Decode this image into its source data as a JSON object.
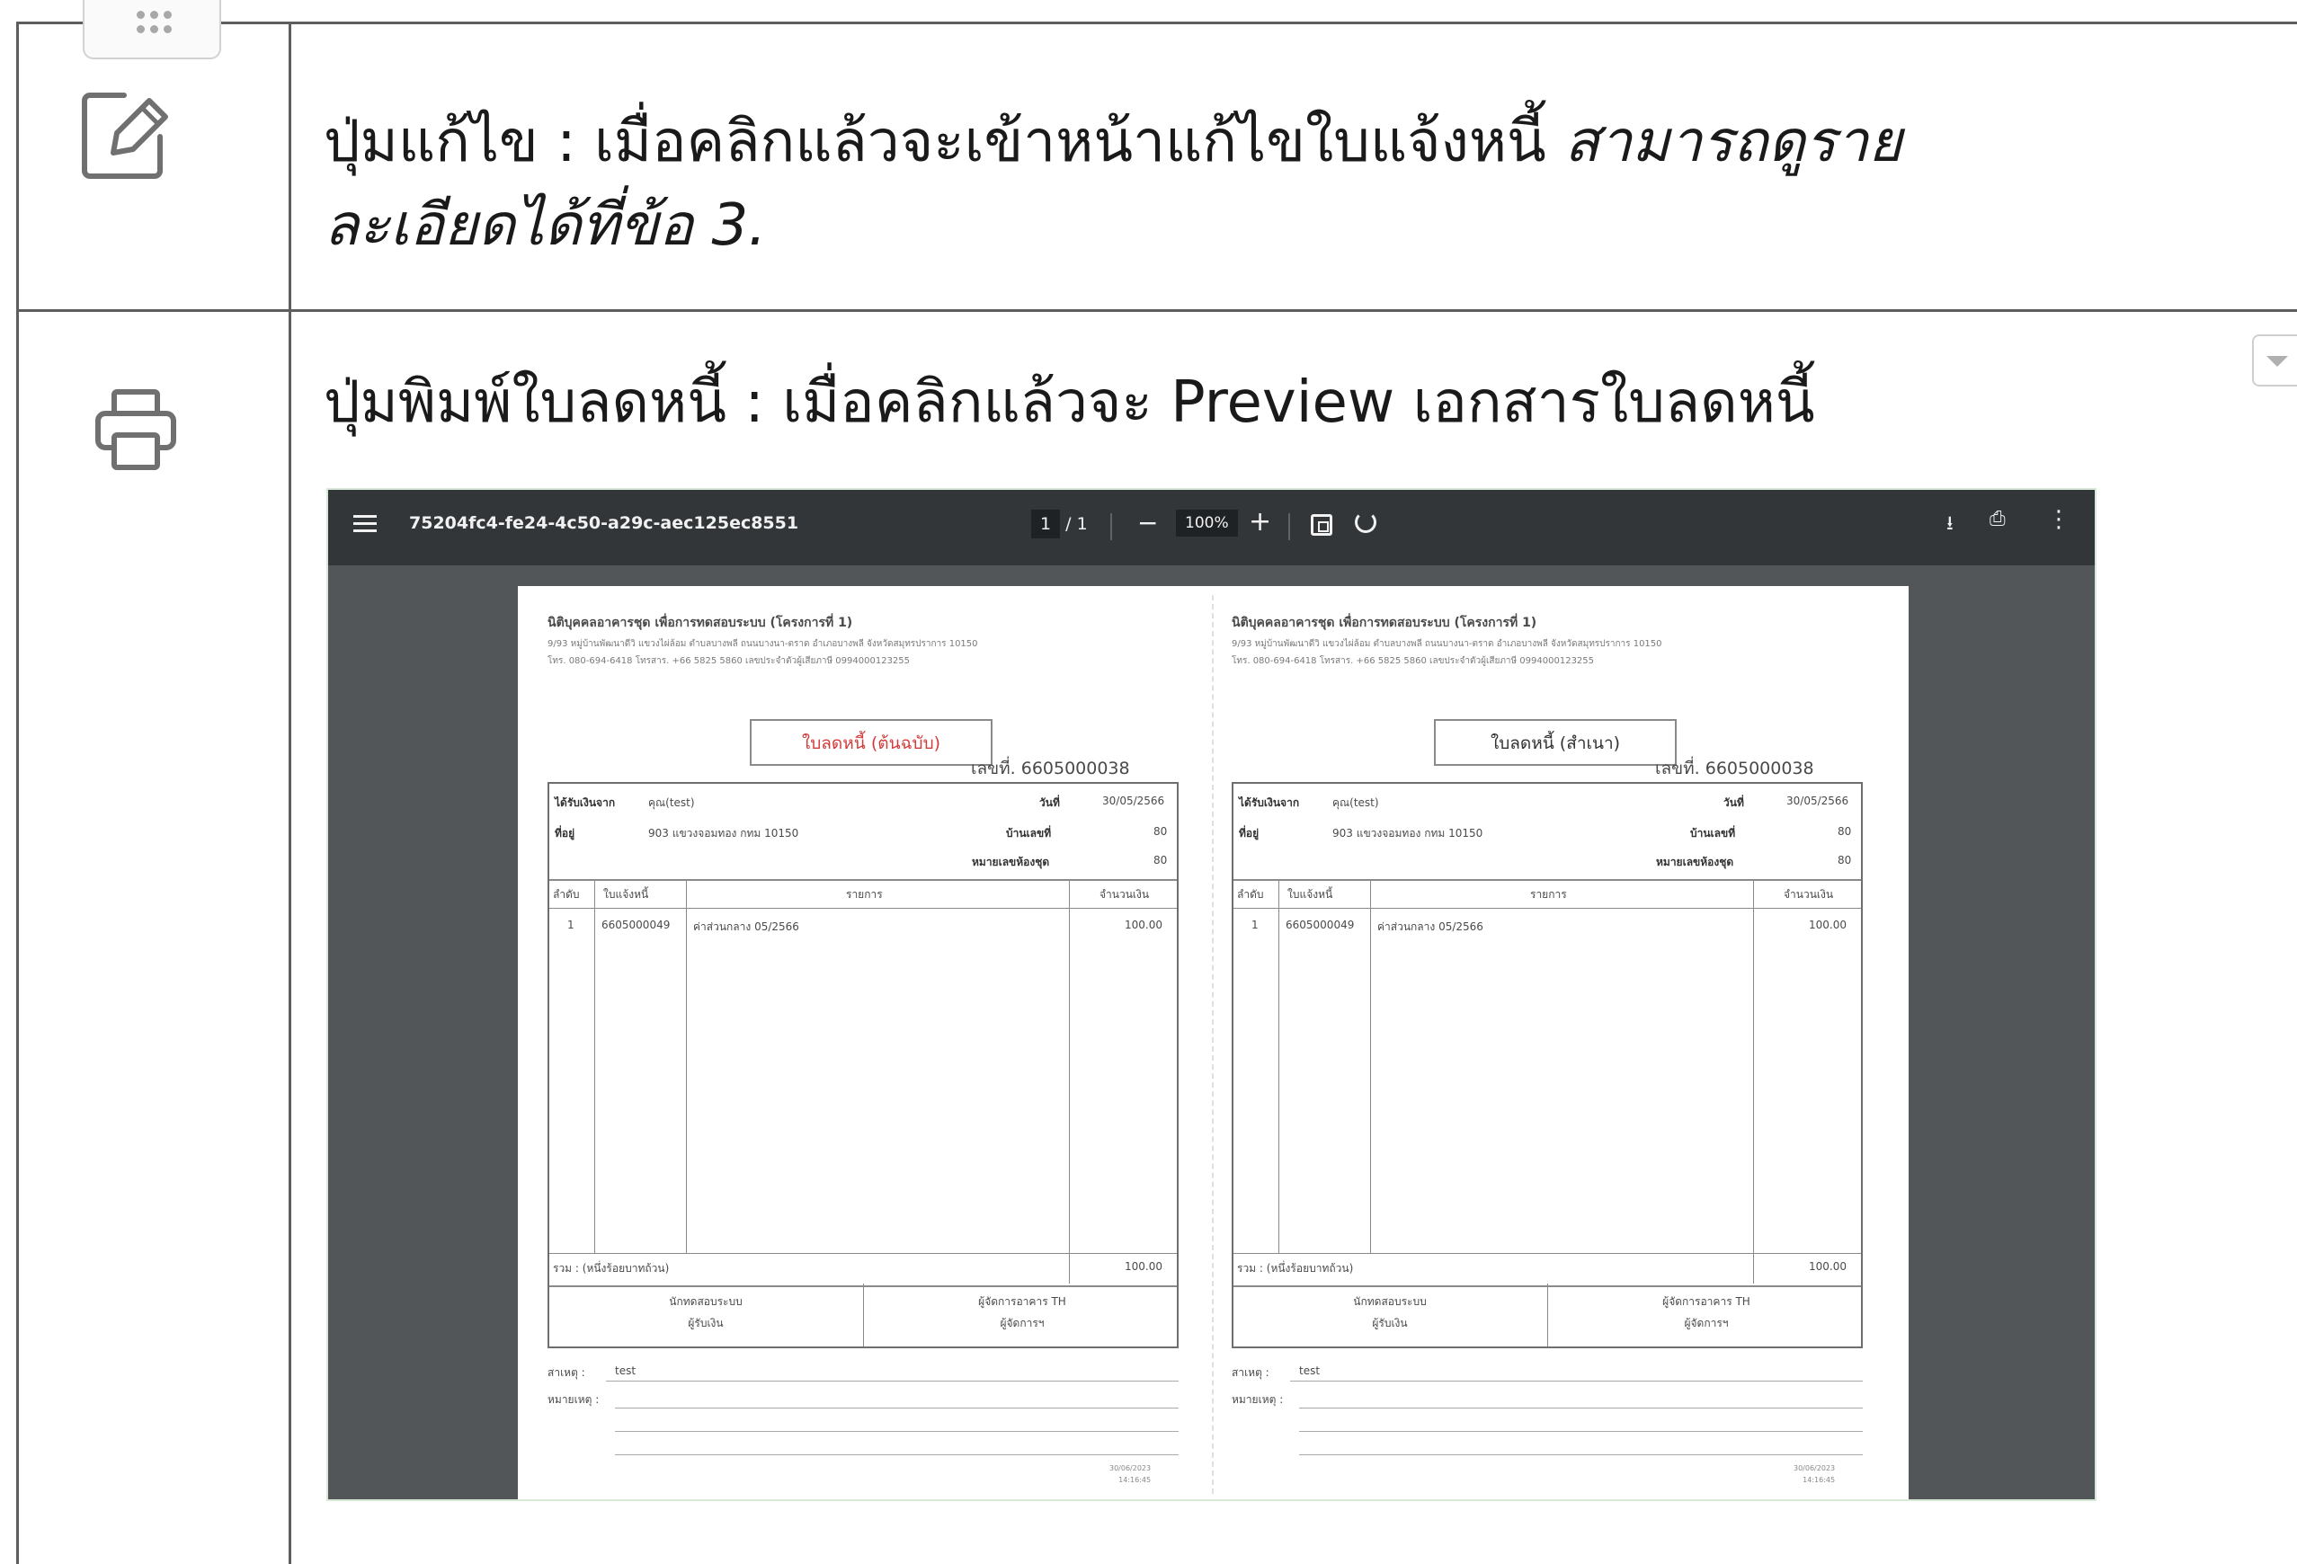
{
  "rows": [
    {
      "icon": "edit-icon",
      "text_plain": "ปุ่มแก้ไข : เมื่อคลิกแล้วจะเข้าหน้าแก้ไขใบแจ้งหนี้ ",
      "text_italic_1": "สามารถดูราย",
      "text_italic_2": "ละเอียดได้ที่ข้อ 3."
    },
    {
      "icon": "printer-icon",
      "text": "ปุ่มพิมพ์ใบลดหนี้ : เมื่อคลิกแล้วจะ Preview เอกสารใบลดหนี้"
    }
  ],
  "viewer": {
    "filename": "75204fc4-fe24-4c50-a29c-aec125ec8551",
    "page_current": "1",
    "page_total": "/ 1",
    "zoom": "100%",
    "minus": "−",
    "plus": "+",
    "download_icon": "download-icon",
    "print_icon": "print-icon",
    "more_icon": "more-vert-icon"
  },
  "document": {
    "org": "นิติบุคคลอาคารชุด เพื่อการทดสอบระบบ (โครงการที่ 1)",
    "addr1": "9/93 หมู่บ้านพัฒนาดีวิ แขวงไผ่ล้อม ตำบลบางพลี ถนนบางนา-ตราด อำเภอบางพลี จังหวัดสมุทรปราการ 10150",
    "addr2": "โทร. 080-694-6418 โทรสาร. +66 5825 5860 เลขประจำตัวผู้เสียภาษี 0994000123255",
    "doc_no": "เลขที่. 6605000038",
    "receive_from_label": "ได้รับเงินจาก",
    "receive_from": "คุณ(test)",
    "date_label": "วันที่",
    "date": "30/05/2566",
    "address_label": "ที่อยู่",
    "address": "903 แขวงจอมทอง กทม 10150",
    "house_no_label": "บ้านเลขที่",
    "house_no": "80",
    "unit_label": "หมายเลขห้องชุด",
    "unit": "80",
    "col_no": "ลำดับ",
    "col_invoice": "ใบแจ้งหนี้",
    "col_item": "รายการ",
    "col_amount": "จำนวนเงิน",
    "item_no": "1",
    "item_invoice": "6605000049",
    "item_desc": "ค่าส่วนกลาง 05/2566",
    "item_amount": "100.00",
    "total_label": "รวม : (หนึ่งร้อยบาทถ้วน)",
    "total_amount": "100.00",
    "sig_left_1": "นักทดสอบระบบ",
    "sig_left_2": "ผู้รับเงิน",
    "sig_right_1": "ผู้จัดการอาคาร TH",
    "sig_right_2": "ผู้จัดการฯ",
    "cause_label": "สาเหตุ :",
    "cause": "test",
    "remark_label": "หมายเหตุ :",
    "stamp_date": "30/06/2023",
    "stamp_time": "14:16:45",
    "title_original": "ใบลดหนี้ (ต้นฉบับ)",
    "title_copy": "ใบลดหนี้ (สำเนา)",
    "title_original_color": "#d33b3b",
    "title_copy_color": "#333333"
  }
}
